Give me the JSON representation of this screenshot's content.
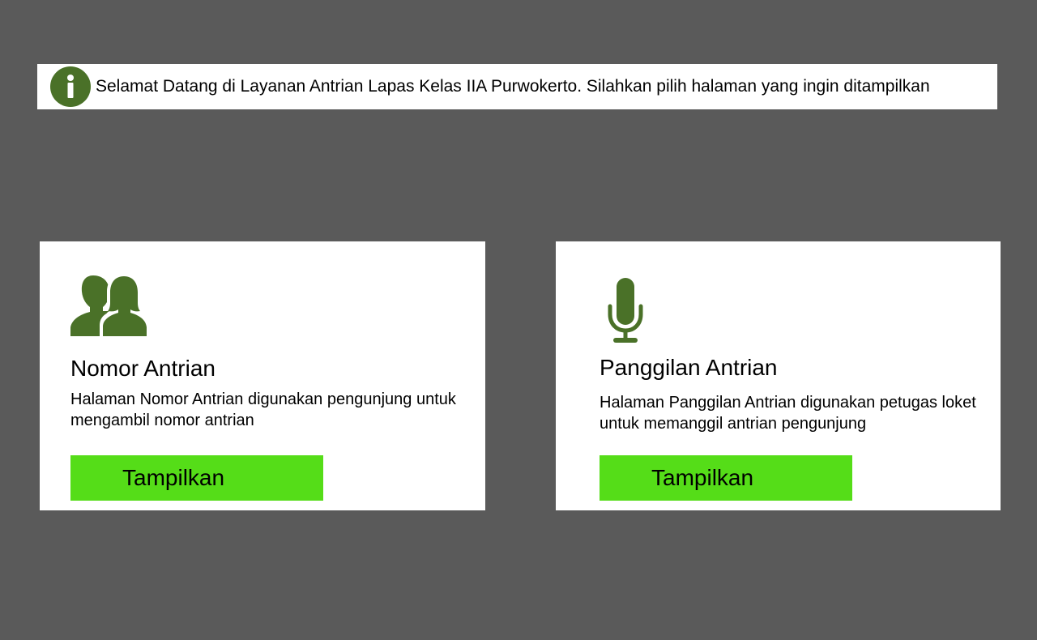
{
  "banner": {
    "text": "Selamat Datang di Layanan Antrian Lapas Kelas IIA Purwokerto. Silahkan pilih halaman yang ingin ditampilkan",
    "icon": "info-icon"
  },
  "cards": [
    {
      "icon": "users-icon",
      "title": "Nomor Antrian",
      "description": "Halaman Nomor Antrian digunakan pengunjung untuk mengambil nomor antrian",
      "button_label": "Tampilkan"
    },
    {
      "icon": "microphone-icon",
      "title": "Panggilan Antrian",
      "description": "Halaman Panggilan Antrian digunakan petugas loket untuk memanggil antrian pengunjung",
      "button_label": "Tampilkan"
    }
  ],
  "colors": {
    "background": "#5a5a5a",
    "icon_green": "#4a7128",
    "button_green": "#55dd18",
    "card": "#ffffff"
  }
}
